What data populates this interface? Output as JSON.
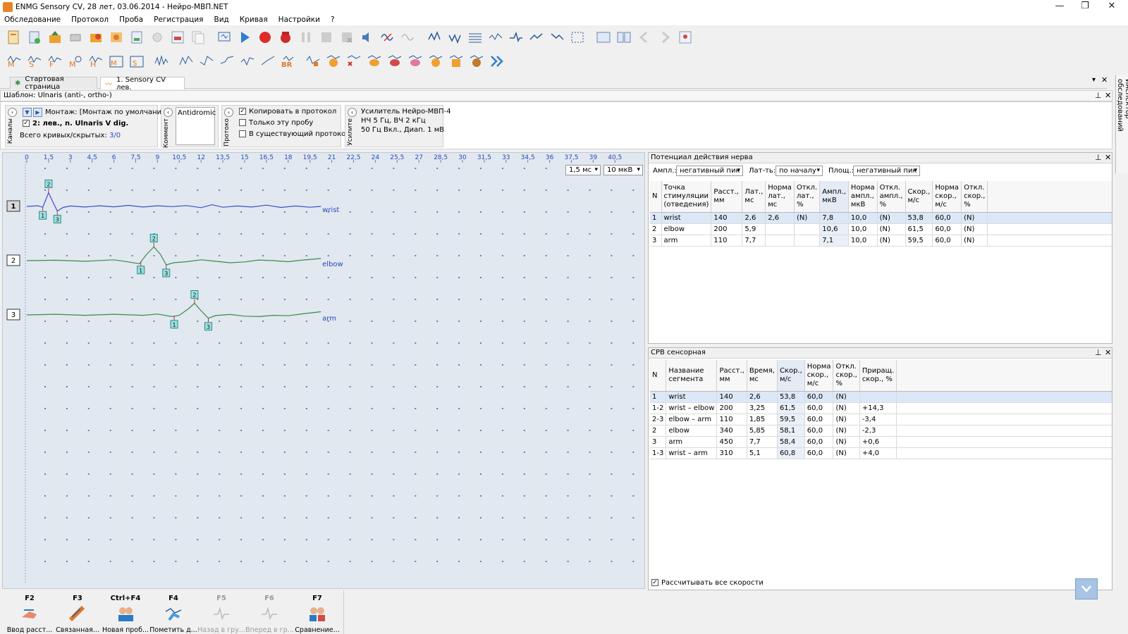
{
  "window": {
    "title": "ENMG Sensory CV, 28 лет, 03.06.2014 - Нейро-МВП.NET",
    "min": "—",
    "max": "❐",
    "close": "✕"
  },
  "menu": [
    "Обследование",
    "Протокол",
    "Проба",
    "Регистрация",
    "Вид",
    "Кривая",
    "Настройки",
    "?"
  ],
  "tabs": {
    "start": "Стартовая страница",
    "active": "1. Sensory CV лев."
  },
  "inspector_label": "Инспектор обследований",
  "template": "Шаблон: Ulnaris (anti-, ortho-)",
  "channels": {
    "side_label": "Каналы",
    "montage": "Монтаж: [Монтаж по умолчанию]",
    "channel": "2: лев., n. Ulnaris V dig.",
    "curves_label": "Всего кривых/скрытых:",
    "curves_value": "3/0"
  },
  "comment": {
    "side_label": "Коммент",
    "text": "Antidromic"
  },
  "protocol": {
    "side_label": "Протоко",
    "copy": "Копировать в протокол",
    "only": "Только эту пробу",
    "existing": "В существующий протокол"
  },
  "amplifier": {
    "side_label": "Усилите",
    "line1": "Усилитель Нейро-МВП-4",
    "line2": "НЧ  5 Гц, ВЧ  2 кГц",
    "line3": "50 Гц  Вкл., Диап. 1 мВ"
  },
  "graph": {
    "ticks": [
      "0",
      "1,5",
      "3",
      "4,5",
      "6",
      "7,5",
      "9",
      "10,5",
      "12",
      "13,5",
      "15",
      "16,5",
      "18",
      "19,5",
      "21",
      "22,5",
      "24",
      "25,5",
      "27",
      "28,5",
      "30",
      "31,5",
      "33",
      "34,5",
      "36",
      "37,5",
      "39",
      "40,5"
    ],
    "time_scale": "1,5 мс",
    "amp_scale": "10 мкВ",
    "traces": [
      {
        "num": "1",
        "label": "wrist",
        "color": "#3b4fc8",
        "points": [
          [
            0,
            0
          ],
          [
            1.5,
            -0.3
          ],
          [
            2.2,
            0.4
          ],
          [
            3.0,
            -6.5
          ],
          [
            3.6,
            -2
          ],
          [
            4.2,
            2.2
          ],
          [
            5.0,
            0.5
          ],
          [
            6,
            -0.2
          ],
          [
            8,
            0.3
          ],
          [
            10,
            -0.3
          ],
          [
            12,
            0.2
          ],
          [
            14,
            -0.5
          ],
          [
            16,
            0.3
          ],
          [
            18,
            -0.3
          ],
          [
            20,
            0.1
          ],
          [
            22,
            -0.4
          ],
          [
            24,
            0.6
          ],
          [
            25.5,
            -0.8
          ],
          [
            27,
            0.4
          ],
          [
            29,
            -0.2
          ],
          [
            31,
            0.3
          ],
          [
            33,
            -0.6
          ],
          [
            35,
            0.5
          ],
          [
            37,
            -0.2
          ],
          [
            39,
            0.4
          ],
          [
            40.5,
            0
          ]
        ],
        "markers": [
          {
            "n": "1",
            "t": 2.2,
            "pos": "below"
          },
          {
            "n": "2",
            "t": 3.0,
            "pos": "above"
          },
          {
            "n": "3",
            "t": 4.2,
            "pos": "below"
          }
        ]
      },
      {
        "num": "2",
        "label": "elbow",
        "color": "#3a8a4a",
        "points": [
          [
            0,
            0
          ],
          [
            4,
            -0.2
          ],
          [
            8,
            0.3
          ],
          [
            12,
            -0.4
          ],
          [
            14,
            0.6
          ],
          [
            15.5,
            1.5
          ],
          [
            16.5,
            -3
          ],
          [
            17.5,
            -6.5
          ],
          [
            18.4,
            -3
          ],
          [
            19.2,
            2
          ],
          [
            20.2,
            1
          ],
          [
            22,
            0.5
          ],
          [
            24,
            -0.4
          ],
          [
            26,
            0.3
          ],
          [
            28,
            1
          ],
          [
            30,
            0.6
          ],
          [
            32,
            -0.3
          ],
          [
            34,
            0
          ],
          [
            36,
            0.5
          ],
          [
            38,
            -0.3
          ],
          [
            40.5,
            -1
          ]
        ],
        "markers": [
          {
            "n": "1",
            "t": 15.7,
            "pos": "below"
          },
          {
            "n": "2",
            "t": 17.5,
            "pos": "above"
          },
          {
            "n": "3",
            "t": 19.2,
            "pos": "below"
          }
        ]
      },
      {
        "num": "3",
        "label": "arm",
        "color": "#3a8a4a",
        "points": [
          [
            0,
            0
          ],
          [
            4,
            -0.3
          ],
          [
            8,
            0.2
          ],
          [
            12,
            -0.3
          ],
          [
            16,
            0.2
          ],
          [
            18,
            -0.4
          ],
          [
            20,
            0.8
          ],
          [
            21,
            0.2
          ],
          [
            22.3,
            -3
          ],
          [
            23.1,
            -5.5
          ],
          [
            24,
            -2
          ],
          [
            25,
            1.6
          ],
          [
            26,
            0.3
          ],
          [
            28,
            -0.2
          ],
          [
            30,
            0.6
          ],
          [
            32,
            0.8
          ],
          [
            34,
            0.2
          ],
          [
            36,
            0.4
          ],
          [
            38,
            -0.5
          ],
          [
            40.5,
            -1.5
          ]
        ],
        "markers": [
          {
            "n": "1",
            "t": 20.3,
            "pos": "below"
          },
          {
            "n": "2",
            "t": 23.1,
            "pos": "above"
          },
          {
            "n": "3",
            "t": 25,
            "pos": "below"
          }
        ]
      }
    ]
  },
  "nerve": {
    "title": "Потенциал действия нерва",
    "ampl_label": "Ампл.:",
    "ampl_value": "негативный пик",
    "lat_label": "Лат-ть:",
    "lat_value": "по началу",
    "area_label": "Площ.:",
    "area_value": "негативный пик",
    "headers": [
      "N",
      "Точка стимуляции (отведения)",
      "Расст., мм",
      "Лат., мс",
      "Норма лат., мс",
      "Откл. лат., %",
      "Ампл., мкВ",
      "Норма ампл., мкВ",
      "Откл. ампл., %",
      "Скор., м/с",
      "Норма скор., м/с",
      "Откл. скор., %"
    ],
    "rows": [
      [
        "1",
        "wrist",
        "140",
        "2,6",
        "2,6",
        "(N)",
        "7,8",
        "10,0",
        "(N)",
        "53,8",
        "60,0",
        "(N)"
      ],
      [
        "2",
        "elbow",
        "200",
        "5,9",
        "",
        "",
        "10,6",
        "10,0",
        "(N)",
        "61,5",
        "60,0",
        "(N)"
      ],
      [
        "3",
        "arm",
        "110",
        "7,7",
        "",
        "",
        "7,1",
        "10,0",
        "(N)",
        "59,5",
        "60,0",
        "(N)"
      ]
    ]
  },
  "srv": {
    "title": "СРВ сенсорная",
    "headers": [
      "N",
      "Название сегмента",
      "Расст., мм",
      "Время, мс",
      "Скор., м/с",
      "Норма скор., м/с",
      "Откл. скор., %",
      "Приращ. скор., %"
    ],
    "rows": [
      [
        "1",
        "wrist",
        "140",
        "2,6",
        "53,8",
        "60,0",
        "(N)",
        ""
      ],
      [
        "1-2",
        "wrist – elbow",
        "200",
        "3,25",
        "61,5",
        "60,0",
        "(N)",
        "+14,3"
      ],
      [
        "2-3",
        "elbow – arm",
        "110",
        "1,85",
        "59,5",
        "60,0",
        "(N)",
        "-3,4"
      ],
      [
        "2",
        "elbow",
        "340",
        "5,85",
        "58,1",
        "60,0",
        "(N)",
        "-2,3"
      ],
      [
        "3",
        "arm",
        "450",
        "7,7",
        "58,4",
        "60,0",
        "(N)",
        "+0,6"
      ],
      [
        "1-3",
        "wrist – arm",
        "310",
        "5,1",
        "60,8",
        "60,0",
        "(N)",
        "+4,0"
      ]
    ],
    "calc_all": "Рассчитывать все скорости"
  },
  "fkeys": [
    {
      "key": "F2",
      "label": "Ввод расст...",
      "enabled": true
    },
    {
      "key": "F3",
      "label": "Связанная...",
      "enabled": true
    },
    {
      "key": "Ctrl+F4",
      "label": "Новая проб...",
      "enabled": true
    },
    {
      "key": "F4",
      "label": "Пометить д...",
      "enabled": true
    },
    {
      "key": "F5",
      "label": "Назад в гру...",
      "enabled": false
    },
    {
      "key": "F6",
      "label": "Вперед в гр...",
      "enabled": false
    },
    {
      "key": "F7",
      "label": "Сравнение...",
      "enabled": true
    }
  ]
}
